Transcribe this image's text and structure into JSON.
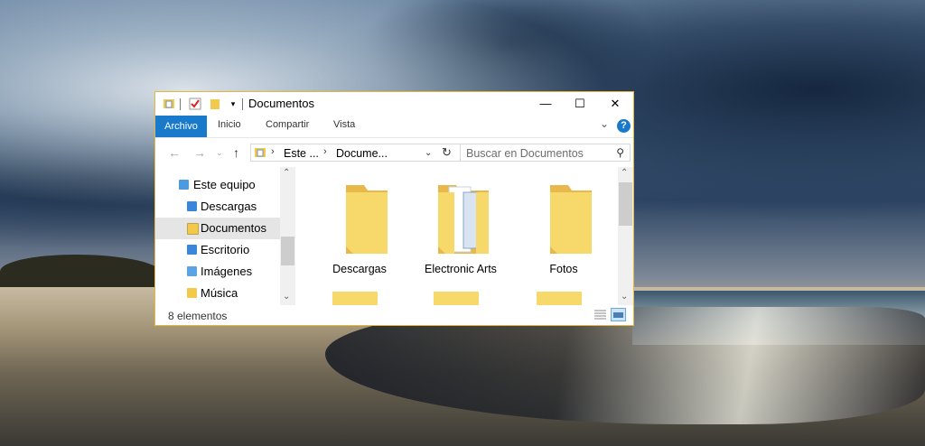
{
  "window": {
    "title": "Documentos",
    "controls": {
      "minimize": "—",
      "maximize": "☐",
      "close": "✕"
    }
  },
  "ribbon": {
    "tabs": [
      "Archivo",
      "Inicio",
      "Compartir",
      "Vista"
    ],
    "help": "?"
  },
  "addressbar": {
    "crumbs": [
      "Este ...",
      "Docume..."
    ],
    "search_placeholder": "Buscar en Documentos"
  },
  "navpane": {
    "items": [
      {
        "label": "Este equipo",
        "icon": "computer-icon"
      },
      {
        "label": "Descargas",
        "icon": "downloads-folder-icon"
      },
      {
        "label": "Documentos",
        "icon": "documents-folder-icon",
        "selected": true
      },
      {
        "label": "Escritorio",
        "icon": "desktop-folder-icon"
      },
      {
        "label": "Imágenes",
        "icon": "pictures-folder-icon"
      },
      {
        "label": "Música",
        "icon": "music-folder-icon"
      }
    ]
  },
  "content": {
    "folders": [
      "Descargas",
      "Electronic Arts",
      "Fotos"
    ]
  },
  "status": {
    "item_count": "8 elementos"
  },
  "colors": {
    "accent": "#1979ca",
    "window_border": "#e5b73b",
    "folder": "#f7d86a"
  }
}
